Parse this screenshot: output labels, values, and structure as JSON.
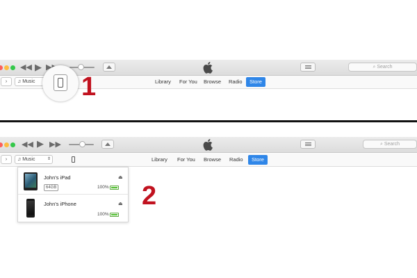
{
  "colors": {
    "store_blue": "#2f86e8",
    "step_red": "#c1121f",
    "battery_green": "#4cbf2b"
  },
  "panel1": {
    "source": "Music",
    "tabs": [
      "Library",
      "For You",
      "Browse",
      "Radio"
    ],
    "store_tab": "Store",
    "search_placeholder": "Search",
    "step": "1"
  },
  "panel2": {
    "source": "Music",
    "tabs": [
      "Library",
      "For You",
      "Browse",
      "Radio"
    ],
    "store_tab": "Store",
    "search_placeholder": "Search",
    "step": "2",
    "devices": [
      {
        "name": "John's iPad",
        "capacity": "64GB",
        "battery": "100%",
        "battery_level": 1.0,
        "icon": "ipad-icon"
      },
      {
        "name": "John's iPhone",
        "battery": "100%",
        "battery_level": 1.0,
        "icon": "iphone-icon"
      }
    ]
  }
}
